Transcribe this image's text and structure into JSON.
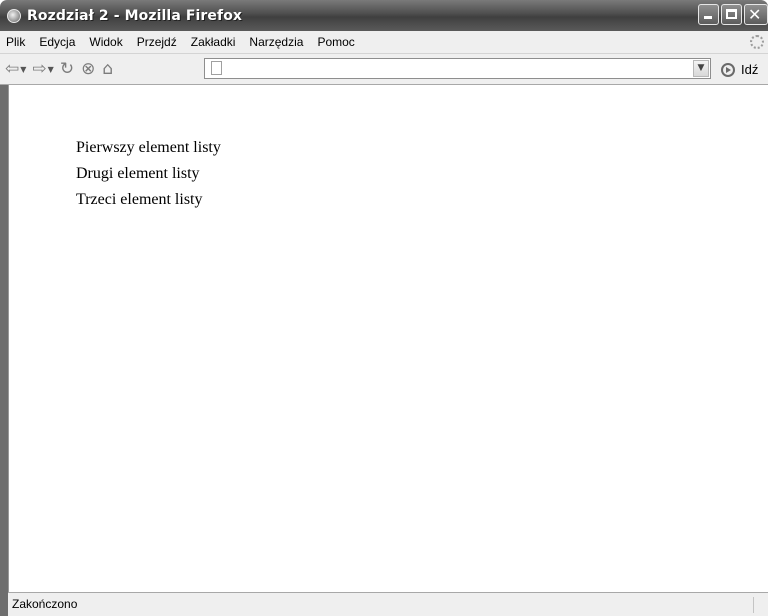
{
  "window": {
    "title": "Rozdział 2 - Mozilla Firefox"
  },
  "menu": {
    "items": [
      {
        "label": "Plik"
      },
      {
        "label": "Edycja"
      },
      {
        "label": "Widok"
      },
      {
        "label": "Przejdź"
      },
      {
        "label": "Zakładki"
      },
      {
        "label": "Narzędzia"
      },
      {
        "label": "Pomoc"
      }
    ]
  },
  "toolbar": {
    "back_icon": "back-arrow-icon",
    "forward_icon": "forward-arrow-icon",
    "reload_icon": "reload-icon",
    "stop_icon": "stop-icon",
    "home_icon": "home-icon",
    "url_value": "",
    "go_label": "Idź"
  },
  "document": {
    "list_items": [
      "Pierwszy element listy",
      "Drugi element listy",
      "Trzeci element listy"
    ]
  },
  "status": {
    "text": "Zakończono"
  },
  "colors": {
    "chrome_bg": "#efefef",
    "titlebar": "#4d4d4d"
  }
}
